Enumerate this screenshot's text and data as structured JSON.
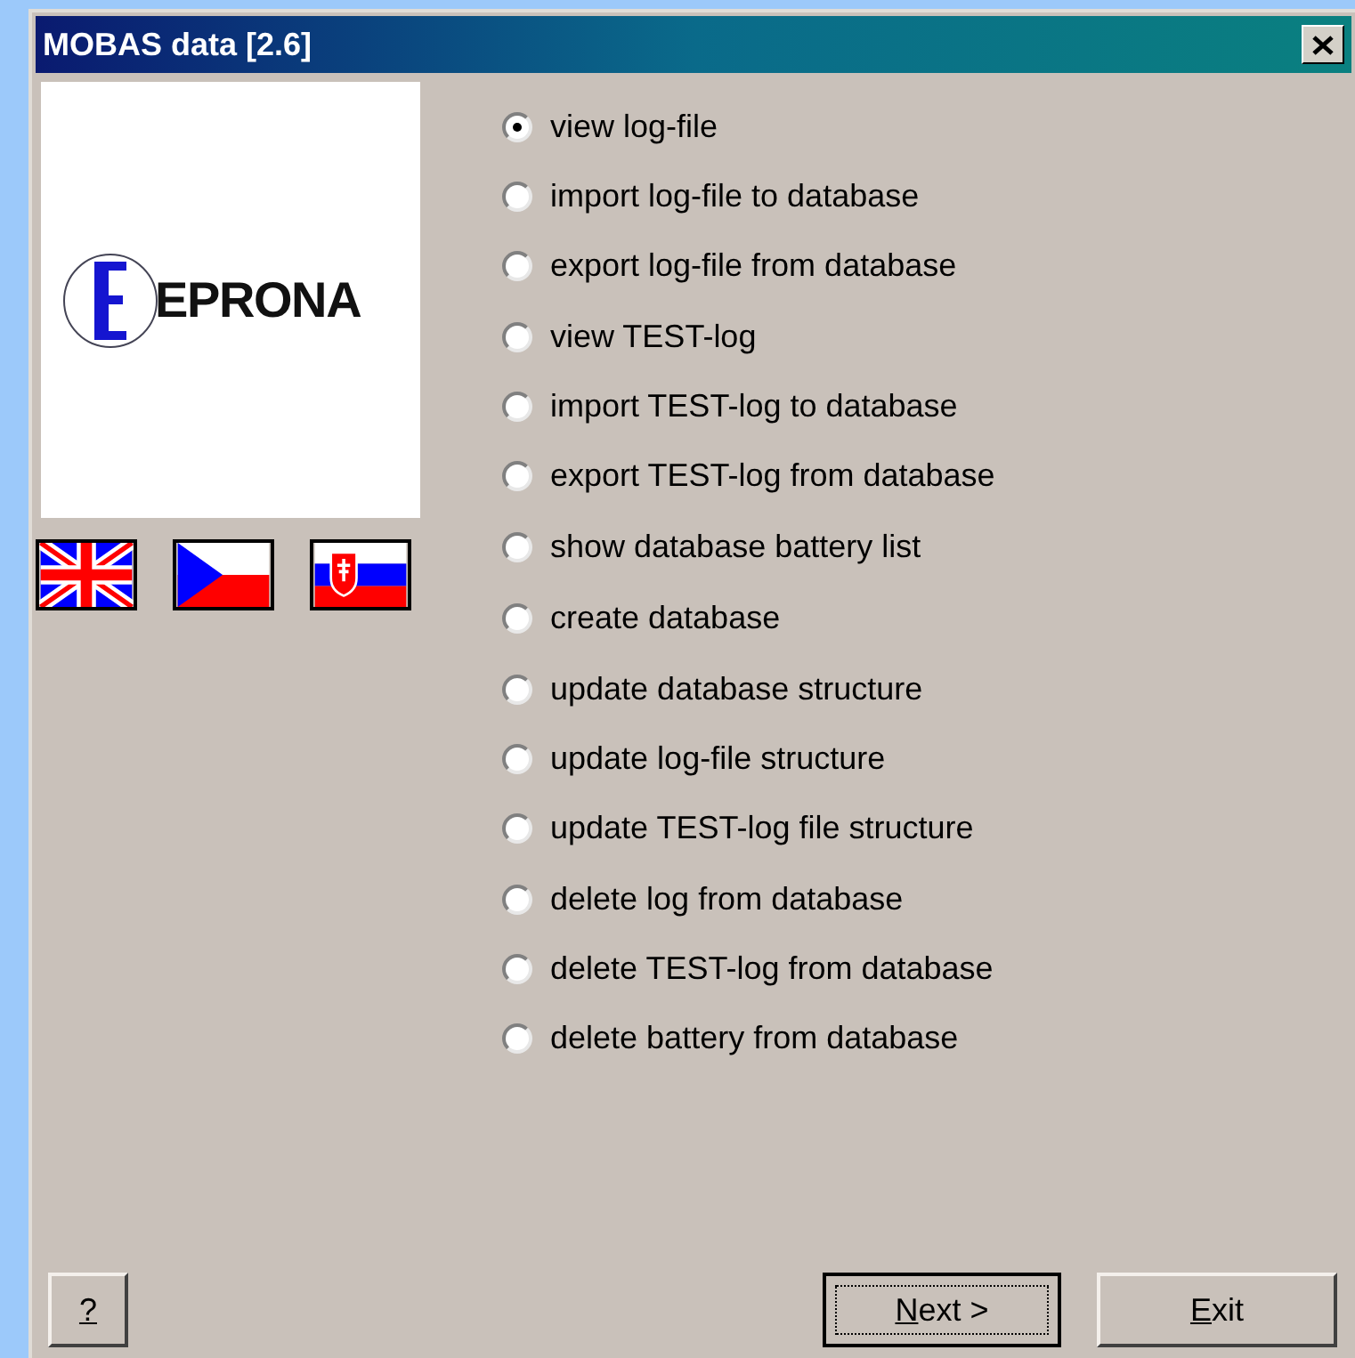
{
  "window": {
    "title": "MOBAS data [2.6]"
  },
  "logo": {
    "text": "EPRONA"
  },
  "flags": [
    {
      "kind": "uk"
    },
    {
      "kind": "cz"
    },
    {
      "kind": "sk"
    }
  ],
  "option_groups": [
    [
      {
        "label": "view log-file",
        "selected": true
      },
      {
        "label": "import log-file to database",
        "selected": false
      },
      {
        "label": "export log-file from database",
        "selected": false
      }
    ],
    [
      {
        "label": "view TEST-log",
        "selected": false
      },
      {
        "label": "import TEST-log to database",
        "selected": false
      },
      {
        "label": "export TEST-log from database",
        "selected": false
      }
    ],
    [
      {
        "label": "show database battery list",
        "selected": false
      }
    ],
    [
      {
        "label": "create database",
        "selected": false
      }
    ],
    [
      {
        "label": "update database structure",
        "selected": false
      },
      {
        "label": "update log-file structure",
        "selected": false
      },
      {
        "label": "update TEST-log file structure",
        "selected": false
      }
    ],
    [
      {
        "label": "delete log from database",
        "selected": false
      },
      {
        "label": "delete TEST-log from database",
        "selected": false
      },
      {
        "label": "delete battery from database",
        "selected": false
      }
    ]
  ],
  "buttons": [
    {
      "label": "?",
      "mnemonic": true,
      "default": false
    },
    {
      "label": "Next >",
      "mnemonic": true,
      "default": true
    },
    {
      "label": "Exit",
      "mnemonic": true,
      "default": false
    }
  ]
}
